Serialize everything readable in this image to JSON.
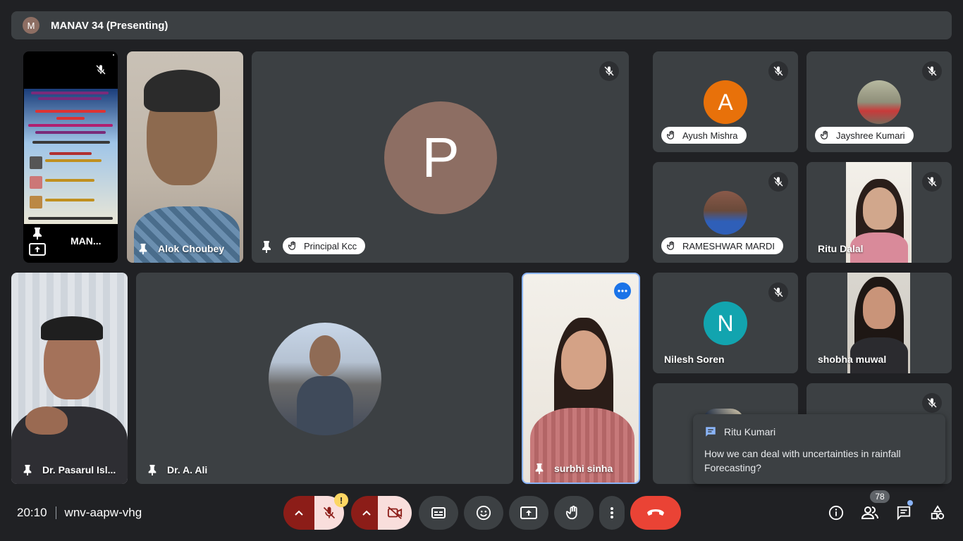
{
  "topbar": {
    "avatar_letter": "M",
    "title": "MANAV 34 (Presenting)"
  },
  "presenter_tile": {
    "name": "MAN..."
  },
  "tiles": {
    "alok": {
      "name": "Alok Choubey"
    },
    "principal": {
      "name": "Principal Kcc",
      "avatar_letter": "P",
      "avatar_color": "#8d6e63"
    },
    "ayush": {
      "name": "Ayush Mishra",
      "avatar_letter": "A",
      "avatar_color": "#e8710a"
    },
    "jayshree": {
      "name": "Jayshree Kumari"
    },
    "rameshwar": {
      "name": "RAMESHWAR MARDI"
    },
    "ritu_dalal": {
      "name": "Ritu Dalal"
    },
    "pasarul": {
      "name": "Dr. Pasarul Isl..."
    },
    "ali": {
      "name": "Dr. A. Ali"
    },
    "surbhi": {
      "name": "surbhi sinha"
    },
    "nilesh": {
      "name": "Nilesh Soren",
      "avatar_letter": "N",
      "avatar_color": "#12a4af"
    },
    "shobha": {
      "name": "shobha muwal"
    }
  },
  "chat_toast": {
    "sender": "Ritu Kumari",
    "message": "How we can deal with uncertainties in rainfall Forecasting?"
  },
  "bottombar": {
    "time": "20:10",
    "meeting_code": "wnv-aapw-vhg",
    "mic_warning": "!",
    "participants_count": "78"
  },
  "colors": {
    "end_call": "#ea4335",
    "mic_off_bg": "#8c1d18",
    "accent": "#1a73e8"
  }
}
